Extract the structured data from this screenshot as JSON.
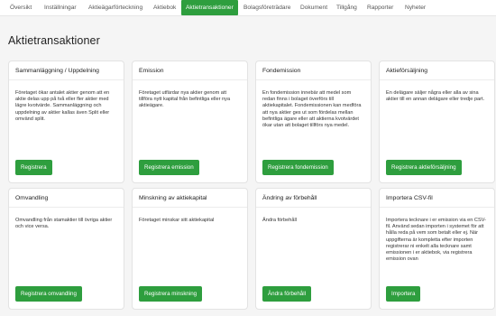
{
  "nav": {
    "items": [
      {
        "label": "Översikt"
      },
      {
        "label": "Inställningar"
      },
      {
        "label": "Aktieägarförteckning"
      },
      {
        "label": "Aktiebok"
      },
      {
        "label": "Aktietransaktioner",
        "active": true
      },
      {
        "label": "Bolagsföreträdare"
      },
      {
        "label": "Dokument"
      },
      {
        "label": "Tillgång"
      },
      {
        "label": "Rapporter"
      },
      {
        "label": "Nyheter"
      }
    ]
  },
  "page": {
    "title": "Aktietransaktioner"
  },
  "cards": [
    {
      "title": "Sammanläggning / Uppdelning",
      "text": "Företaget ökar antalet aktier genom att en aktie delas upp på två eller fler aktier med lägre kvotvärde. Sammanläggning och uppdelning av aktier kallas även Split eller omvänd split.",
      "button": "Registrera"
    },
    {
      "title": "Emission",
      "text": "Företaget utfärdar nya aktier genom att tillföra nytt kapital från befintliga eller nya aktieägare.",
      "button": "Registrera emission"
    },
    {
      "title": "Fondemission",
      "text": "En fondemission innebär att medel som redan finns i bolaget överförs till aktiekapitalet. Fondemissionen kan medföra att nya aktier ges ut som fördelas mellan befintliga ägare eller att aktierna kvotvärdet ökar utan att bolaget tillförs nya medel.",
      "button": "Registrera fondemission"
    },
    {
      "title": "Aktieförsäljning",
      "text": "En delägare säljer några eller alla av sina aktier till en annan delägare eller tredje part.",
      "button": "Registrera aktieförsäljning"
    },
    {
      "title": "Omvandling",
      "text": "Omvandling från stamaktier till övriga aktier och vice versa.",
      "button": "Registrera omvandling"
    },
    {
      "title": "Minskning av aktiekapital",
      "text": "Företaget minskar sitt aktiekapital",
      "button": "Registrera minskning"
    },
    {
      "title": "Ändring av förbehåll",
      "text": "Ändra förbehåll",
      "button": "Ändra förbehåll"
    },
    {
      "title": "Importera CSV-fil",
      "text": "Importera tecknare i er emission via en CSV-fil. Använd sedan importen i systemet för att hålla reda på vem som betalt eller ej. När uppgifterna är kompletta efter importen registrerar ni enkelt alla tecknare samt emissionen i er aktiebok, via registrera emission ovan",
      "button": "Importera"
    }
  ]
}
